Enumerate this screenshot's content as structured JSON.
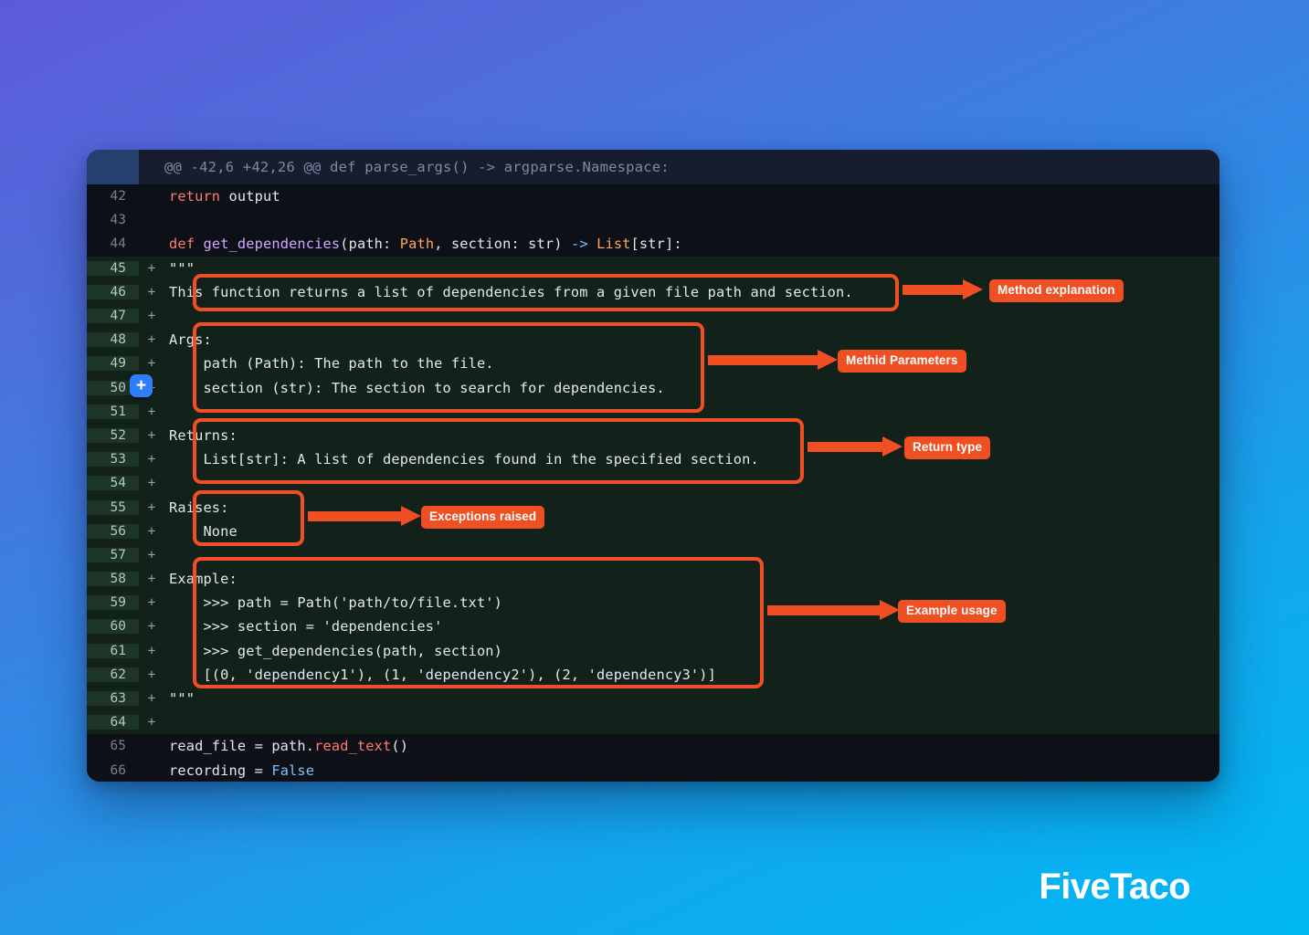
{
  "brand": {
    "name": "FiveTaco"
  },
  "diff": {
    "hunk_header": "@@ -42,6 +42,26 @@ def parse_args() -> argparse.Namespace:",
    "add_button_label": "+",
    "add_sign": "+",
    "lines": [
      {
        "number": "42",
        "sign": "",
        "type": "context",
        "text": "return output"
      },
      {
        "number": "43",
        "sign": "",
        "type": "context",
        "text": ""
      },
      {
        "number": "44",
        "sign": "",
        "type": "context",
        "text": "def get_dependencies(path: Path, section: str) -> List[str]:"
      },
      {
        "number": "45",
        "sign": "+",
        "type": "added",
        "text": "\"\"\""
      },
      {
        "number": "46",
        "sign": "+",
        "type": "added",
        "text": "This function returns a list of dependencies from a given file path and section."
      },
      {
        "number": "47",
        "sign": "+",
        "type": "added",
        "text": ""
      },
      {
        "number": "48",
        "sign": "+",
        "type": "added",
        "text": "Args:"
      },
      {
        "number": "49",
        "sign": "+",
        "type": "added",
        "text": "    path (Path): The path to the file."
      },
      {
        "number": "50",
        "sign": "+",
        "type": "added",
        "text": "    section (str): The section to search for dependencies."
      },
      {
        "number": "51",
        "sign": "+",
        "type": "added",
        "text": ""
      },
      {
        "number": "52",
        "sign": "+",
        "type": "added",
        "text": "Returns:"
      },
      {
        "number": "53",
        "sign": "+",
        "type": "added",
        "text": "    List[str]: A list of dependencies found in the specified section."
      },
      {
        "number": "54",
        "sign": "+",
        "type": "added",
        "text": ""
      },
      {
        "number": "55",
        "sign": "+",
        "type": "added",
        "text": "Raises:"
      },
      {
        "number": "56",
        "sign": "+",
        "type": "added",
        "text": "    None"
      },
      {
        "number": "57",
        "sign": "+",
        "type": "added",
        "text": ""
      },
      {
        "number": "58",
        "sign": "+",
        "type": "added",
        "text": "Example:"
      },
      {
        "number": "59",
        "sign": "+",
        "type": "added",
        "text": "    >>> path = Path('path/to/file.txt')"
      },
      {
        "number": "60",
        "sign": "+",
        "type": "added",
        "text": "    >>> section = 'dependencies'"
      },
      {
        "number": "61",
        "sign": "+",
        "type": "added",
        "text": "    >>> get_dependencies(path, section)"
      },
      {
        "number": "62",
        "sign": "+",
        "type": "added",
        "text": "    [(0, 'dependency1'), (1, 'dependency2'), (2, 'dependency3')]"
      },
      {
        "number": "63",
        "sign": "+",
        "type": "added",
        "text": "\"\"\""
      },
      {
        "number": "64",
        "sign": "+",
        "type": "added",
        "text": ""
      },
      {
        "number": "65",
        "sign": "",
        "type": "context",
        "text": "read_file = path.read_text()"
      },
      {
        "number": "66",
        "sign": "",
        "type": "context",
        "text": "recording = False"
      }
    ]
  },
  "annotations": [
    {
      "id": "method-explanation",
      "label": "Method explanation"
    },
    {
      "id": "method-parameters",
      "label": "Methid Parameters"
    },
    {
      "id": "return-type",
      "label": "Return type"
    },
    {
      "id": "exceptions-raised",
      "label": "Exceptions raised"
    },
    {
      "id": "example-usage",
      "label": "Example usage"
    }
  ],
  "colors": {
    "accent": "#f04f23",
    "add_bg": "#12221a",
    "add_gutter": "#1d3527",
    "context_bg": "#0d1117",
    "header_bg": "#161d2e",
    "add_button": "#2d7ff9"
  }
}
